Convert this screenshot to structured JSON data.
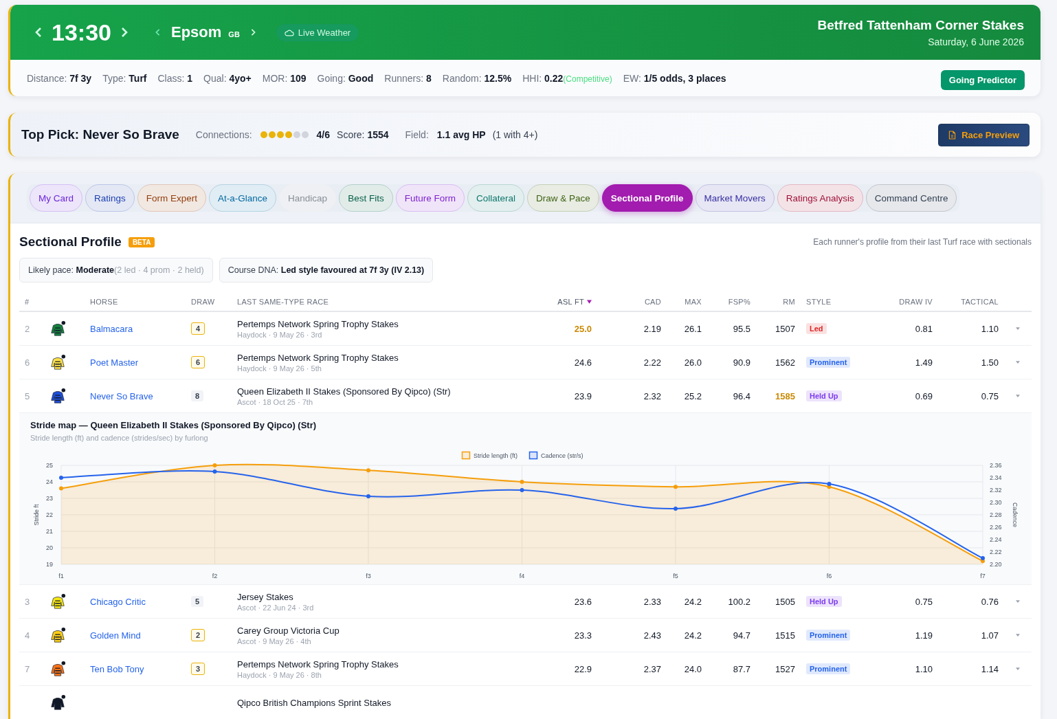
{
  "header": {
    "time": "13:30",
    "course": "Epsom",
    "country": "GB",
    "weather_button": "Live Weather",
    "race_title": "Betfred Tattenham Corner Stakes",
    "date": "Saturday, 6 June 2026"
  },
  "stats": [
    {
      "label": "Distance:",
      "value": "7f 3y"
    },
    {
      "label": "Type:",
      "value": "Turf"
    },
    {
      "label": "Class:",
      "value": "1"
    },
    {
      "label": "Qual:",
      "value": "4yo+"
    },
    {
      "label": "MOR:",
      "value": "109"
    },
    {
      "label": "Going:",
      "value": "Good"
    },
    {
      "label": "Runners:",
      "value": "8"
    },
    {
      "label": "Random:",
      "value": "12.5%"
    },
    {
      "label": "HHI:",
      "value": "0.22",
      "note": "(Competitive)"
    },
    {
      "label": "EW:",
      "value": "1/5 odds, 3 places"
    }
  ],
  "going_button": "Going Predictor",
  "top_pick": {
    "title": "Top Pick: Never So Brave",
    "connections_label": "Connections:",
    "stars": 4,
    "connections_value": "4/6",
    "score_label": "Score:",
    "score": "1554",
    "field_label": "Field:",
    "field_value": "1.1 avg HP",
    "field_note": "(1 with 4+)",
    "preview_button": "Race Preview"
  },
  "tabs": [
    {
      "label": "My Card",
      "color": "#6d28d9",
      "selected": false,
      "disabled": false
    },
    {
      "label": "Ratings",
      "color": "#1e40af",
      "selected": false,
      "disabled": false
    },
    {
      "label": "Form Expert",
      "color": "#92400e",
      "selected": false,
      "disabled": false
    },
    {
      "label": "At-a-Glance",
      "color": "#0369a1",
      "selected": false,
      "disabled": false
    },
    {
      "label": "Handicap",
      "color": "#8a9099",
      "selected": false,
      "disabled": true
    },
    {
      "label": "Best Fits",
      "color": "#065f46",
      "selected": false,
      "disabled": false
    },
    {
      "label": "Future Form",
      "color": "#7e22ce",
      "selected": false,
      "disabled": false
    },
    {
      "label": "Collateral",
      "color": "#0f766e",
      "selected": false,
      "disabled": false
    },
    {
      "label": "Draw & Pace",
      "color": "#3f6212",
      "selected": false,
      "disabled": false
    },
    {
      "label": "Sectional Profile",
      "color": "#a21caf",
      "selected": true,
      "disabled": false
    },
    {
      "label": "Market Movers",
      "color": "#3730a3",
      "selected": false,
      "disabled": false
    },
    {
      "label": "Ratings Analysis",
      "color": "#9f1239",
      "selected": false,
      "disabled": false
    },
    {
      "label": "Command Centre",
      "color": "#334155",
      "selected": false,
      "disabled": false
    }
  ],
  "section": {
    "title": "Sectional Profile",
    "badge": "BETA",
    "note": "Each runner's profile from their last Turf race with sectionals"
  },
  "summary_chips": [
    {
      "label": "Likely pace:",
      "value": "Moderate",
      "note": "(2 led · 4 prom · 2 held)"
    },
    {
      "label": "Course DNA:",
      "value": "Led style favoured at 7f 3y (IV 2.13)"
    }
  ],
  "table": {
    "columns": [
      {
        "label": "#",
        "sorted": false
      },
      {
        "label": "HORSE",
        "sorted": false
      },
      {
        "label": "DRAW",
        "sorted": false
      },
      {
        "label": "LAST SAME-TYPE RACE",
        "sorted": false
      },
      {
        "label": "ASL FT",
        "sorted": true
      },
      {
        "label": "CAD",
        "sorted": false
      },
      {
        "label": "MAX",
        "sorted": false
      },
      {
        "label": "FSP%",
        "sorted": false
      },
      {
        "label": "RM",
        "sorted": false
      },
      {
        "label": "STYLE",
        "sorted": false
      },
      {
        "label": "DRAW IV",
        "sorted": false
      },
      {
        "label": "TACTICAL",
        "sorted": false
      }
    ],
    "rows": [
      {
        "no": "2",
        "horse": "Balmacara",
        "color": "#15803d",
        "draw": "4",
        "draw_boxed": true,
        "race": "Pertemps Network Spring Trophy Stakes",
        "race_meta": "Haydock · 9 May 26 · 3rd",
        "asl": "25.0",
        "asl_best": true,
        "cad": "2.19",
        "max": "26.1",
        "fsp": "95.5",
        "rm": "1507",
        "rm_best": false,
        "style": {
          "label": "Led",
          "color": "#dc2626"
        },
        "draw_iv": "0.81",
        "tactical": "1.10"
      },
      {
        "no": "6",
        "horse": "Poet Master",
        "color": "#fde047",
        "draw": "6",
        "draw_boxed": true,
        "race": "Pertemps Network Spring Trophy Stakes",
        "race_meta": "Haydock · 9 May 26 · 5th",
        "asl": "24.6",
        "asl_best": false,
        "cad": "2.22",
        "max": "26.0",
        "fsp": "90.9",
        "rm": "1562",
        "rm_best": false,
        "style": {
          "label": "Prominent",
          "color": "#2563eb"
        },
        "draw_iv": "1.49",
        "tactical": "1.50"
      },
      {
        "no": "5",
        "horse": "Never So Brave",
        "color": "#1d4ed8",
        "draw": "8",
        "draw_boxed": false,
        "race": "Queen Elizabeth II Stakes (Sponsored By Qipco) (Str)",
        "race_meta": "Ascot · 18 Oct 25 · 7th",
        "asl": "23.9",
        "asl_best": false,
        "cad": "2.32",
        "max": "25.2",
        "fsp": "96.4",
        "rm": "1585",
        "rm_best": true,
        "style": {
          "label": "Held Up",
          "color": "#7c3aed"
        },
        "draw_iv": "0.69",
        "tactical": "0.75",
        "detail": {
          "title": "Stride map — Queen Elizabeth II Stakes (Sponsored By Qipco) (Str)",
          "subtitle": "Stride length (ft) and cadence (strides/sec) by furlong",
          "chart_data": {
            "type": "area",
            "grid": true,
            "legend": "top",
            "ylabel": "Stride ft",
            "y2label": "Cadence",
            "categories": [
              "f1",
              "f2",
              "f3",
              "f4",
              "f5",
              "f6",
              "f7"
            ],
            "ylim": [
              19,
              25
            ],
            "yticks": [
              19,
              20,
              21,
              22,
              23,
              24,
              25
            ],
            "y2lim": [
              2.2,
              2.36
            ],
            "y2ticks": [
              {
                "value": 2.2,
                "label": "2.20"
              },
              {
                "value": 2.22,
                "label": "2.22"
              },
              {
                "value": 2.24,
                "label": "2.24"
              },
              {
                "value": 2.26,
                "label": "2.26"
              },
              {
                "value": 2.28,
                "label": "2.28"
              },
              {
                "value": 2.3,
                "label": "2.30"
              },
              {
                "value": 2.32,
                "label": "2.32"
              },
              {
                "value": 2.34,
                "label": "2.34"
              },
              {
                "value": 2.36,
                "label": "2.36"
              }
            ],
            "series": [
              {
                "name": "Stride length (ft)",
                "color": "#f59e0b",
                "marker": true,
                "values": [
                  23.6,
                  25.0,
                  24.7,
                  24.0,
                  23.7,
                  23.7,
                  19.2
                ]
              },
              {
                "name": "Cadence (str/s)",
                "color": "#2563eb",
                "type": "line",
                "marker": true,
                "axis": "y2",
                "values": [
                  2.34,
                  2.35,
                  2.31,
                  2.32,
                  2.29,
                  2.33,
                  2.21
                ]
              }
            ]
          }
        }
      },
      {
        "no": "3",
        "horse": "Chicago Critic",
        "color": "#f5e614",
        "draw": "5",
        "draw_boxed": false,
        "race": "Jersey Stakes",
        "race_meta": "Ascot · 22 Jun 24 · 3rd",
        "asl": "23.6",
        "asl_best": false,
        "cad": "2.33",
        "max": "24.2",
        "fsp": "100.2",
        "rm": "1505",
        "rm_best": false,
        "style": {
          "label": "Held Up",
          "color": "#7c3aed"
        },
        "draw_iv": "0.75",
        "tactical": "0.76"
      },
      {
        "no": "4",
        "horse": "Golden Mind",
        "color": "#facc15",
        "draw": "2",
        "draw_boxed": true,
        "race": "Carey Group Victoria Cup",
        "race_meta": "Ascot · 9 May 26 · 4th",
        "asl": "23.3",
        "asl_best": false,
        "cad": "2.43",
        "max": "24.2",
        "fsp": "94.7",
        "rm": "1515",
        "rm_best": false,
        "style": {
          "label": "Prominent",
          "color": "#2563eb"
        },
        "draw_iv": "1.19",
        "tactical": "1.07"
      },
      {
        "no": "7",
        "horse": "Ten Bob Tony",
        "color": "#f97316",
        "draw": "3",
        "draw_boxed": true,
        "race": "Pertemps Network Spring Trophy Stakes",
        "race_meta": "Haydock · 9 May 26 · 8th",
        "asl": "22.9",
        "asl_best": false,
        "cad": "2.37",
        "max": "24.0",
        "fsp": "87.7",
        "rm": "1527",
        "rm_best": false,
        "style": {
          "label": "Prominent",
          "color": "#2563eb"
        },
        "draw_iv": "1.10",
        "tactical": "1.14"
      },
      {
        "race": "Qipco British Champions Sprint Stakes",
        "color": "#111827"
      }
    ]
  }
}
